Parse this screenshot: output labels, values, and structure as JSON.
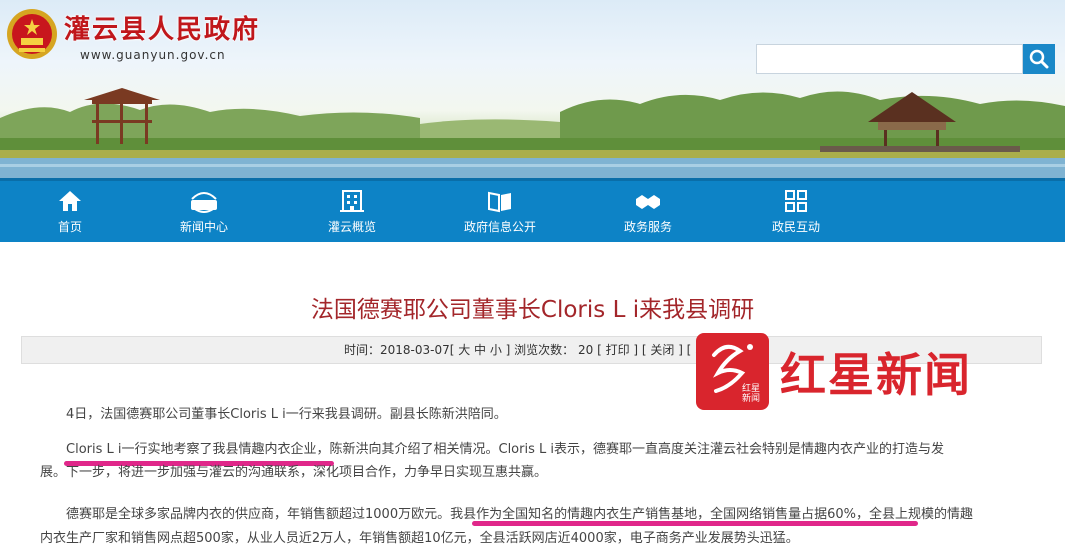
{
  "header": {
    "site_title": "灌云县人民政府",
    "site_url": "www.guanyun.gov.cn",
    "search": {
      "placeholder": "",
      "icon": "search-icon"
    }
  },
  "nav": {
    "items": [
      {
        "label": "首页",
        "icon": "home-icon"
      },
      {
        "label": "新闻中心",
        "icon": "news-icon"
      },
      {
        "label": "灌云概览",
        "icon": "building-icon"
      },
      {
        "label": "政府信息公开",
        "icon": "book-icon"
      },
      {
        "label": "政务服务",
        "icon": "handshake-icon"
      },
      {
        "label": "政民互动",
        "icon": "grid-icon"
      }
    ]
  },
  "article": {
    "title": "法国德赛耶公司董事长Cloris L i来我县调研",
    "meta": "时间：2018-03-07[ 大 中 小 ] 浏览次数： 20 [ 打印 ] [ 关闭 ] [ 收",
    "paragraphs": {
      "p1": "4日，法国德赛耶公司董事长Cloris L i一行来我县调研。副县长陈新洪陪同。",
      "p2_line1": "Cloris L i一行实地考察了我县情趣内衣企业，陈新洪向其介绍了相关情况。Cloris L i表示，德赛耶一直高度关注灌云社会特别是情趣内衣产业的打造与发",
      "p2_line2": "展。下一步，将进一步加强与灌云的沟通联系，深化项目合作，力争早日实现互惠共赢。",
      "p3_line1": "德赛耶是全球多家品牌内衣的供应商，年销售额超过1000万欧元。我县作为全国知名的情趣内衣生产销售基地，全国网络销售量占据60%，全县上规模的情趣",
      "p3_line2": "内衣生产厂家和销售网点超500家，从业人员近2万人，年销售额超10亿元，全县活跃网店近4000家，电子商务产业发展势头迅猛。"
    }
  },
  "watermark": {
    "brand": "红星新闻",
    "logo_small": "红星新闻",
    "brand_color": "#d9252d"
  },
  "colors": {
    "nav_bg": "#0d83c6",
    "title_red": "#a3262a",
    "site_title_red": "#c0171b",
    "highlight_underline": "#e0278a"
  }
}
